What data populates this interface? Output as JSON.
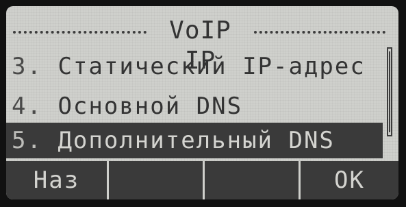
{
  "header": {
    "title": "VoIP IP"
  },
  "menu": {
    "items": [
      {
        "number": "3.",
        "label": "Статический IP-адрес",
        "selected": false
      },
      {
        "number": "4.",
        "label": "Основной DNS",
        "selected": false
      },
      {
        "number": "5.",
        "label": "Дополнительный DNS",
        "selected": true
      }
    ]
  },
  "softkeys": {
    "back": "Наз",
    "key2": "",
    "key3": "",
    "ok": "OK"
  },
  "colors": {
    "lcd_background": "#cfd0cc",
    "text": "#333333",
    "highlight": "#3a3a3a",
    "highlight_text": "#d4d4d0"
  }
}
